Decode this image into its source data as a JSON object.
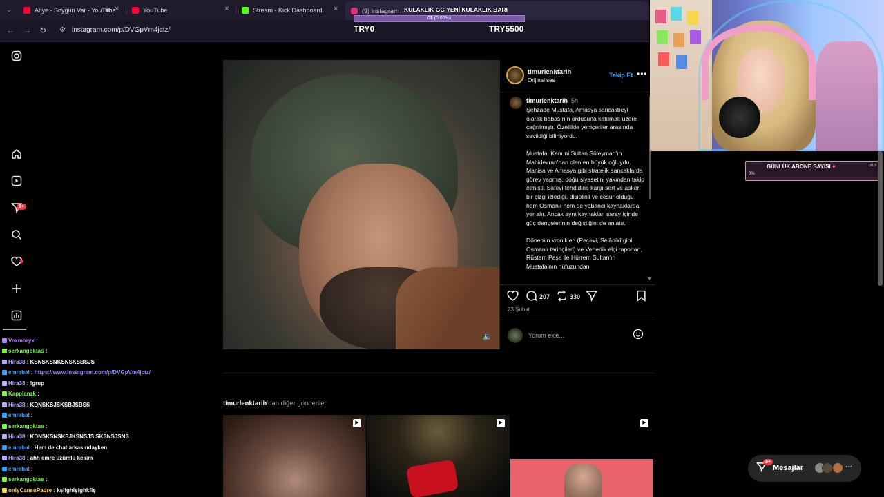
{
  "browser": {
    "tabs": [
      {
        "label": "Atiye - Soygun Var - YouTube",
        "color": "#ff0033"
      },
      {
        "label": "YouTube",
        "color": "#ff0033"
      },
      {
        "label": "Stream - Kick Dashboard",
        "color": "#53fc18"
      },
      {
        "label": "(9) Instagram",
        "color": "#e1306c"
      }
    ],
    "url": "instagram.com/p/DVGpVm4jctz/"
  },
  "kulaklik": {
    "title": "KULAKLIK GG YENİ KULAKLIK BARI",
    "progress_text": "0$ (0.00%)",
    "progress": 0,
    "min_label": "TRY0",
    "max_label": "TRY5500"
  },
  "rail": {
    "notif_badge": "9+"
  },
  "post": {
    "username": "timurlenktarih",
    "audio": "Orijinal ses",
    "follow": "Takip Et",
    "time": "5h",
    "caption": "Şehzade Mustafa, Amasya sancakbeyi olarak babasının ordusuna katılmak üzere çağrılmıştı. Özellikle yeniçeriler arasında sevildiği biliniyordu.\n\nMustafa, Kanuni Sultan Süleyman'ın Mahidevran'dan olan en büyük oğluydu. Manisa ve Amasya gibi stratejik sancaklarda görev yapmış, doğu siyasetini yakından takip etmişti. Safevi tehdidine karşı sert ve askerî bir çizgi izlediği, disiplinli ve cesur olduğu hem Osmanlı hem de yabancı kaynaklarda yer alır. Ancak aynı kaynaklar, saray içinde güç dengelerinin değiştiğini de anlatır.\n\nDönemin kronikleri (Peçevi, Selânikî gibi Osmanlı tarihçileri) ve Venedik elçi raporları, Rüstem Paşa ile Hürrem Sultan'ın Mustafa'nın nüfuzundan",
    "comments": "207",
    "reposts": "330",
    "date": "23 Şubat",
    "comment_placeholder": "Yorum ekle...",
    "more_user": "timurlenktarih",
    "more_suffix": "'dan diğer gönderiler"
  },
  "chat": [
    {
      "user": "Vexmoryx",
      "msg": "",
      "color": "#b084ff"
    },
    {
      "user": "serkangoktas",
      "msg": "",
      "color": "#7cfc4a"
    },
    {
      "user": "Hira38",
      "msg": "KSNSKSNKSNSKSBSJS",
      "color": "#b8b0ff"
    },
    {
      "user": "emrebal",
      "msg": "https://www.instagram.com/p/DVGpVm4jctz/",
      "color": "#3aa0ff"
    },
    {
      "user": "Hira38",
      "msg": "!grup",
      "color": "#b8b0ff"
    },
    {
      "user": "Kapplanzk",
      "msg": "",
      "color": "#7cfc4a"
    },
    {
      "user": "Hira38",
      "msg": "KDNSKSJSKSBJSBSS",
      "color": "#b8b0ff"
    },
    {
      "user": "emrebal",
      "msg": "",
      "color": "#3aa0ff"
    },
    {
      "user": "serkangoktas",
      "msg": "",
      "color": "#7cfc4a"
    },
    {
      "user": "Hira38",
      "msg": "KDNSKSNSKSJKSNSJS SKSNSJSNS",
      "color": "#b8b0ff"
    },
    {
      "user": "emrebal",
      "msg": "Hem de chat arkasındayken",
      "color": "#3aa0ff"
    },
    {
      "user": "Hira38",
      "msg": "ahh emre üzümlü kekim",
      "color": "#b8b0ff"
    },
    {
      "user": "emrebal",
      "msg": "",
      "color": "#3aa0ff"
    },
    {
      "user": "serkangoktas",
      "msg": "",
      "color": "#7cfc4a"
    },
    {
      "user": "onlyCansuPadre",
      "msg": "kşlfghlşfghkflş",
      "color": "#ffd54a"
    }
  ],
  "overlay": {
    "abone_title": "GÜNLÜK ABONE SAYISI",
    "abone_pct": "0%",
    "abone_count": "0/10",
    "abone_progress": 0
  },
  "messages": {
    "label": "Mesajlar",
    "badge": "9+"
  }
}
